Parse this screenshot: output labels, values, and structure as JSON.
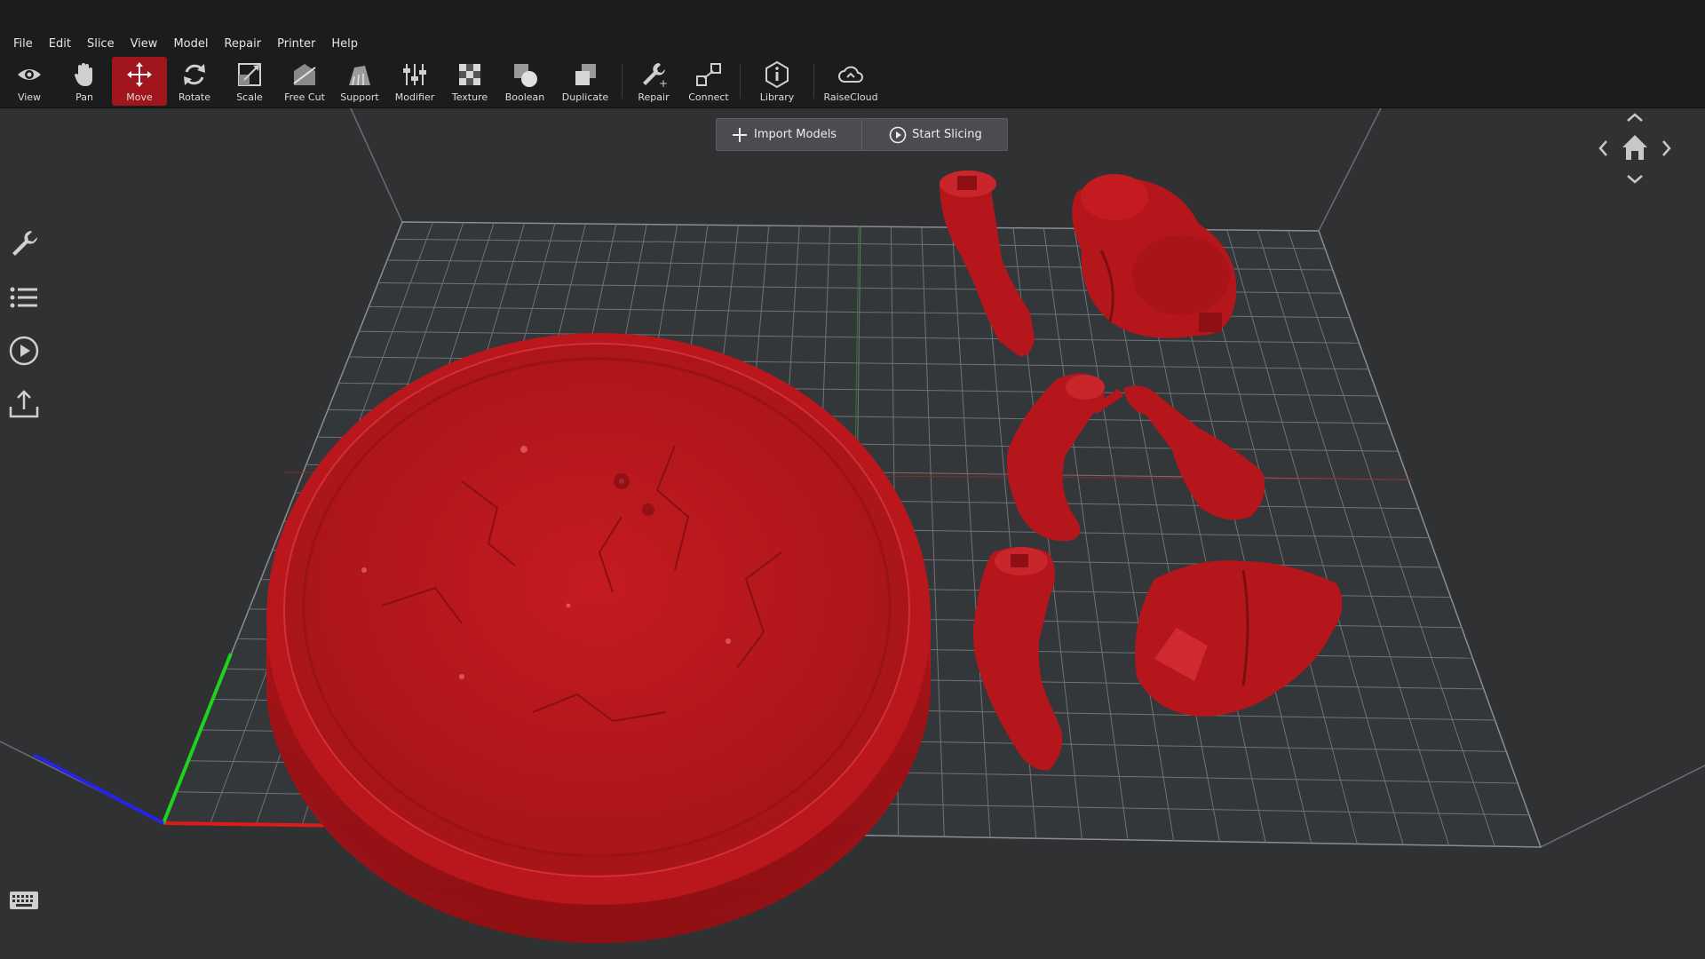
{
  "menu": [
    "File",
    "Edit",
    "Slice",
    "View",
    "Model",
    "Repair",
    "Printer",
    "Help"
  ],
  "toolbar": {
    "view": "View",
    "pan": "Pan",
    "move": "Move",
    "rotate": "Rotate",
    "scale": "Scale",
    "free_cut": "Free Cut",
    "support": "Support",
    "modifier": "Modifier",
    "texture": "Texture",
    "boolean": "Boolean",
    "duplicate": "Duplicate",
    "repair": "Repair",
    "connect": "Connect",
    "library": "Library",
    "raisecloud": "RaiseCloud",
    "active_tool": "Move"
  },
  "actions": {
    "import": "Import Models",
    "slice": "Start Slicing"
  },
  "colors": {
    "accent": "#a0161c",
    "model": "#b5161b",
    "background": "#2f3133",
    "axis_x": "#e01a1a",
    "axis_y": "#1fd21f",
    "axis_z": "#2424e6"
  },
  "icons": {
    "left_sidebar": [
      "wrench-icon",
      "list-icon",
      "play-circle-icon",
      "upload-icon"
    ],
    "bottom_left": "keyboard-icon",
    "navigation": [
      "home-icon",
      "arrow-up-icon",
      "arrow-down-icon",
      "arrow-left-icon",
      "arrow-right-icon"
    ]
  }
}
